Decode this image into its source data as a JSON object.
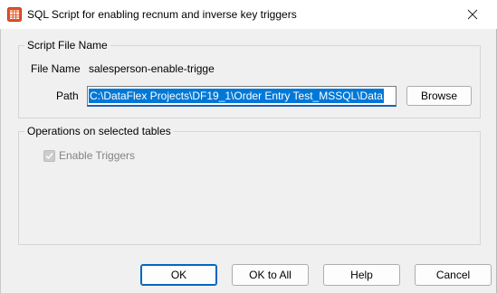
{
  "window": {
    "title": "SQL Script for enabling recnum and inverse key triggers",
    "app_icon": "dataflex-app-icon",
    "close_icon": "close-icon"
  },
  "script_file_group": {
    "legend": "Script File Name",
    "file_name_label": "File Name",
    "file_name_value": "salesperson-enable-trigge",
    "path_label": "Path",
    "path_value": "C:\\DataFlex Projects\\DF19_1\\Order Entry Test_MSSQL\\Data",
    "browse_label": "Browse"
  },
  "operations_group": {
    "legend": "Operations on selected tables",
    "enable_triggers_label": "Enable Triggers",
    "enable_triggers_checked": true,
    "enable_triggers_disabled": true
  },
  "buttons": {
    "ok": "OK",
    "ok_to_all": "OK to All",
    "help": "Help",
    "cancel": "Cancel"
  },
  "colors": {
    "selection": "#0078d7",
    "focus_border": "#0067c0",
    "icon_orange": "#e2542c"
  }
}
